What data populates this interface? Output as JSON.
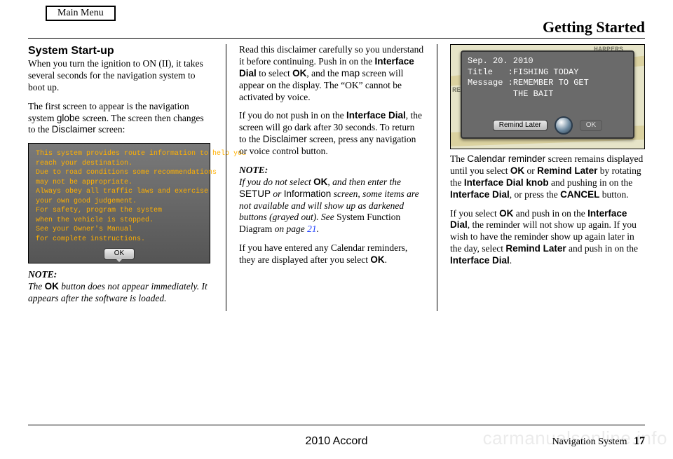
{
  "main_menu_label": "Main Menu",
  "page_header": "Getting Started",
  "section_title": "System Start-up",
  "col1": {
    "p1_a": "When you turn the ignition to ON (II), it takes several seconds for the navigation system to boot up.",
    "p2_a": "The first screen to appear is the navigation system ",
    "p2_globe": "globe",
    "p2_b": " screen. The screen then changes to the ",
    "p2_disc": "Disclaimer",
    "p2_c": " screen:",
    "note_label": "NOTE:",
    "note_a": "The ",
    "note_ok": "OK",
    "note_b": " button does not appear immediately. It appears after the software is loaded."
  },
  "disclaimer": {
    "l1": "This system provides route information to help you",
    "l2": "reach your destination.",
    "l3": "Due to road conditions some recommendations",
    "l4": "may not be appropriate.",
    "l5": "Always obey all traffic laws and exercise",
    "l6": "your own good judgement.",
    "l7": "For safety, program the system",
    "l8": "when the vehicle is stopped.",
    "l9": "See your Owner's Manual",
    "l10": "for complete instructions.",
    "ok": "OK"
  },
  "col2": {
    "p1_a": "Read this disclaimer carefully so you understand it before continuing. Push in on the ",
    "p1_id": "Interface Dial",
    "p1_b": " to select ",
    "p1_ok": "OK",
    "p1_c": ", and the ",
    "p1_map": "map",
    "p1_d": " screen will appear on the display. The “OK” cannot be activated by voice.",
    "p2_a": "If you do not push in on the ",
    "p2_id": "Interface Dial",
    "p2_b": ", the screen will go dark after 30 seconds. To return to the ",
    "p2_disc": "Disclaimer",
    "p2_c": " screen, press any navigation or voice control button.",
    "note_label": "NOTE:",
    "note_a": "If you do not select ",
    "note_ok": "OK",
    "note_b": ", and then enter the ",
    "note_setup": "SETUP",
    "note_or": " or ",
    "note_info": "Information",
    "note_c": " screen, some items are not available and will show up as darkened buttons (grayed out). See ",
    "note_sfd": "System Function Diagram",
    "note_d": " on page ",
    "note_pg": "21",
    "note_e": ".",
    "p3_a": "If you have entered any Calendar reminders, they are displayed after you select ",
    "p3_ok": "OK",
    "p3_b": "."
  },
  "calshot": {
    "map_top": "HARPERS",
    "map_left": "RE",
    "date": "Sep. 20. 2010",
    "title_lbl": "Title   :",
    "title_val": "FISHING TODAY",
    "msg_lbl": "Message :",
    "msg_l1": "REMEMBER TO GET",
    "msg_l2": "THE BAIT",
    "remind": "Remind Later",
    "ok": "OK"
  },
  "col3": {
    "p1_a": "The ",
    "p1_cal": "Calendar reminder",
    "p1_b": " screen remains displayed until you select ",
    "p1_ok": "OK",
    "p1_c": " or ",
    "p1_rl": "Remind Later",
    "p1_d": " by rotating the ",
    "p1_idk": "Interface Dial knob",
    "p1_e": " and pushing in on the ",
    "p1_id": "Interface Dial",
    "p1_f": ", or press the ",
    "p1_cancel": "CANCEL",
    "p1_g": " button.",
    "p2_a": "If you select ",
    "p2_ok": "OK",
    "p2_b": " and push in on the ",
    "p2_id": "Interface Dial",
    "p2_c": ", the reminder will not show up again. If you wish to have the reminder show up again later in the day, select ",
    "p2_rl": "Remind Later",
    "p2_d": " and push in on the ",
    "p2_id2": "Interface Dial",
    "p2_e": "."
  },
  "footer": {
    "center": "2010 Accord",
    "right_label": "Navigation System",
    "page": "17"
  },
  "watermark": "carmanualsonline.info"
}
